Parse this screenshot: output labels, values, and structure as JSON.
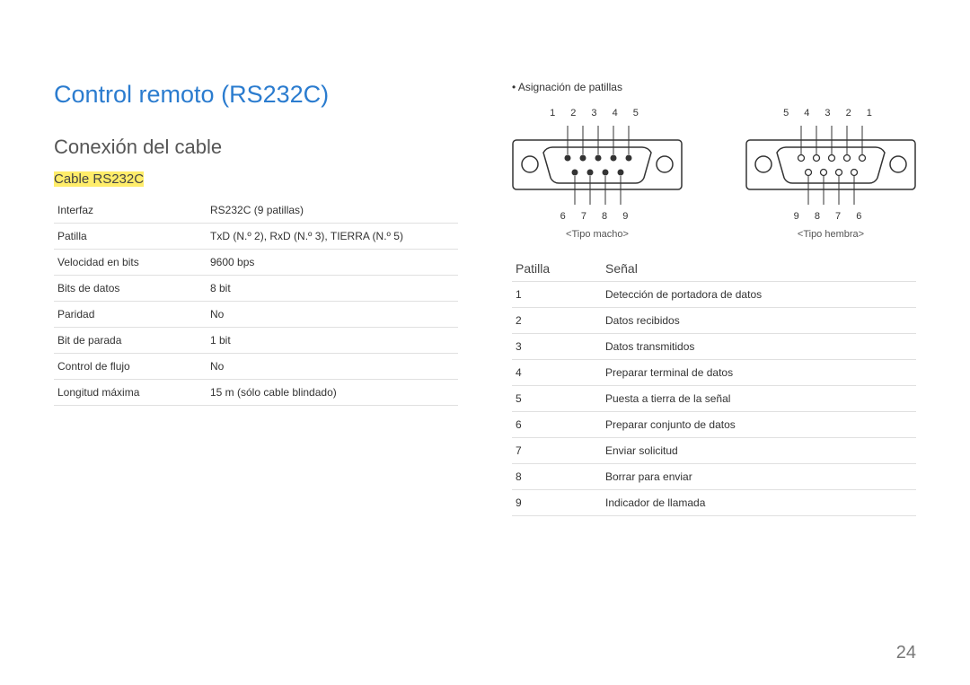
{
  "title": "Control remoto (RS232C)",
  "section": "Conexión del cable",
  "sub": "Cable RS232C",
  "spec_rows": [
    {
      "k": "Interfaz",
      "v": "RS232C (9 patillas)"
    },
    {
      "k": "Patilla",
      "v": "TxD (N.º 2), RxD (N.º 3), TIERRA (N.º 5)"
    },
    {
      "k": "Velocidad en bits",
      "v": "9600 bps"
    },
    {
      "k": "Bits de datos",
      "v": "8 bit"
    },
    {
      "k": "Paridad",
      "v": "No"
    },
    {
      "k": "Bit de parada",
      "v": "1 bit"
    },
    {
      "k": "Control de flujo",
      "v": "No"
    },
    {
      "k": "Longitud máxima",
      "v": "15 m (sólo cable blindado)"
    }
  ],
  "bullet": "Asignación de patillas",
  "conn_male": {
    "top": "1 2 3 4 5",
    "bot": "6 7 8 9",
    "caption": "<Tipo macho>"
  },
  "conn_female": {
    "top": "5 4 3 2 1",
    "bot": "9 8 7 6",
    "caption": "<Tipo hembra>"
  },
  "signals_header": {
    "pin": "Patilla",
    "sig": "Señal"
  },
  "signals": [
    {
      "pin": "1",
      "sig": "Detección de portadora de datos"
    },
    {
      "pin": "2",
      "sig": "Datos recibidos"
    },
    {
      "pin": "3",
      "sig": "Datos transmitidos"
    },
    {
      "pin": "4",
      "sig": "Preparar terminal de datos"
    },
    {
      "pin": "5",
      "sig": "Puesta a tierra de la señal"
    },
    {
      "pin": "6",
      "sig": "Preparar conjunto de datos"
    },
    {
      "pin": "7",
      "sig": "Enviar solicitud"
    },
    {
      "pin": "8",
      "sig": "Borrar para enviar"
    },
    {
      "pin": "9",
      "sig": "Indicador de llamada"
    }
  ],
  "page_number": "24"
}
